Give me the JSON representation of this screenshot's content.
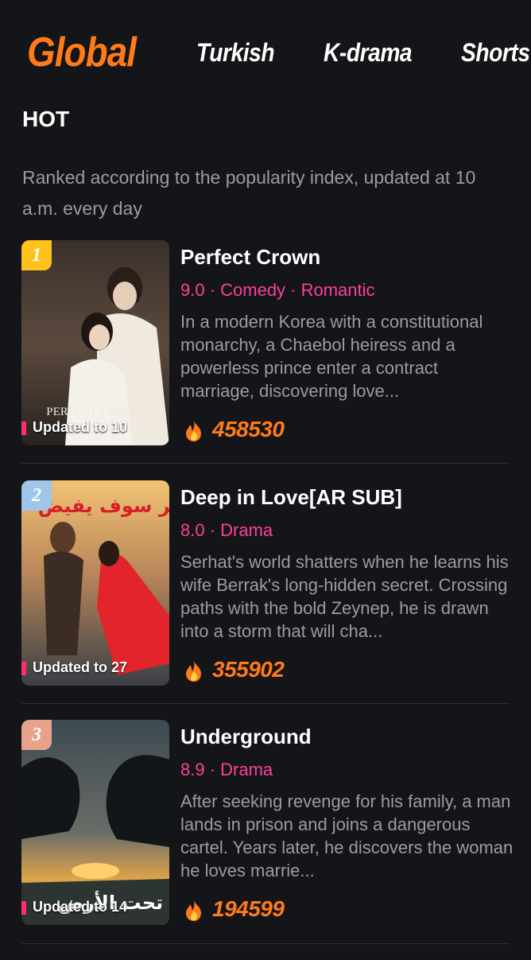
{
  "tabs": [
    "Global",
    "Turkish",
    "K-drama",
    "Shorts"
  ],
  "section_title": "HOT",
  "subtitle": "Ranked according to the popularity index, updated at 10 a.m. every day",
  "items": [
    {
      "rank": "1",
      "rank_color": "#ffc21a",
      "updated": "Updated to 10",
      "title": "Perfect Crown",
      "meta": "9.0 · Comedy · Romantic",
      "desc": "In a modern Korea with a constitutional monarchy, a Chaebol heiress and a powerless prince enter a contract marriage, discovering love...",
      "count": "458530"
    },
    {
      "rank": "2",
      "rank_color": "#9fc6ea",
      "updated": "Updated to 27",
      "title": "Deep in Love[AR SUB]",
      "meta": "8.0 · Drama",
      "desc": "Serhat's world shatters when he learns his wife Berrak's long-hidden secret. Crossing paths with the bold Zeynep, he is drawn into a storm that will cha...",
      "count": "355902"
    },
    {
      "rank": "3",
      "rank_color": "#e8a28a",
      "updated": "Updated to 14",
      "title": "Underground",
      "meta": "8.9 · Drama",
      "desc": "After seeking revenge for his family, a man lands in prison and joins a dangerous cartel. Years later, he discovers the woman he loves marrie...",
      "count": "194599"
    }
  ],
  "poster_text": {
    "p1": "PERFECT CROWN",
    "p2": "هذا البحر سوف يفيض",
    "p3": "تحت الأرض"
  },
  "colors": {
    "accent": "#ff7a1a",
    "meta": "#ff3f9c",
    "background": "#141518"
  }
}
